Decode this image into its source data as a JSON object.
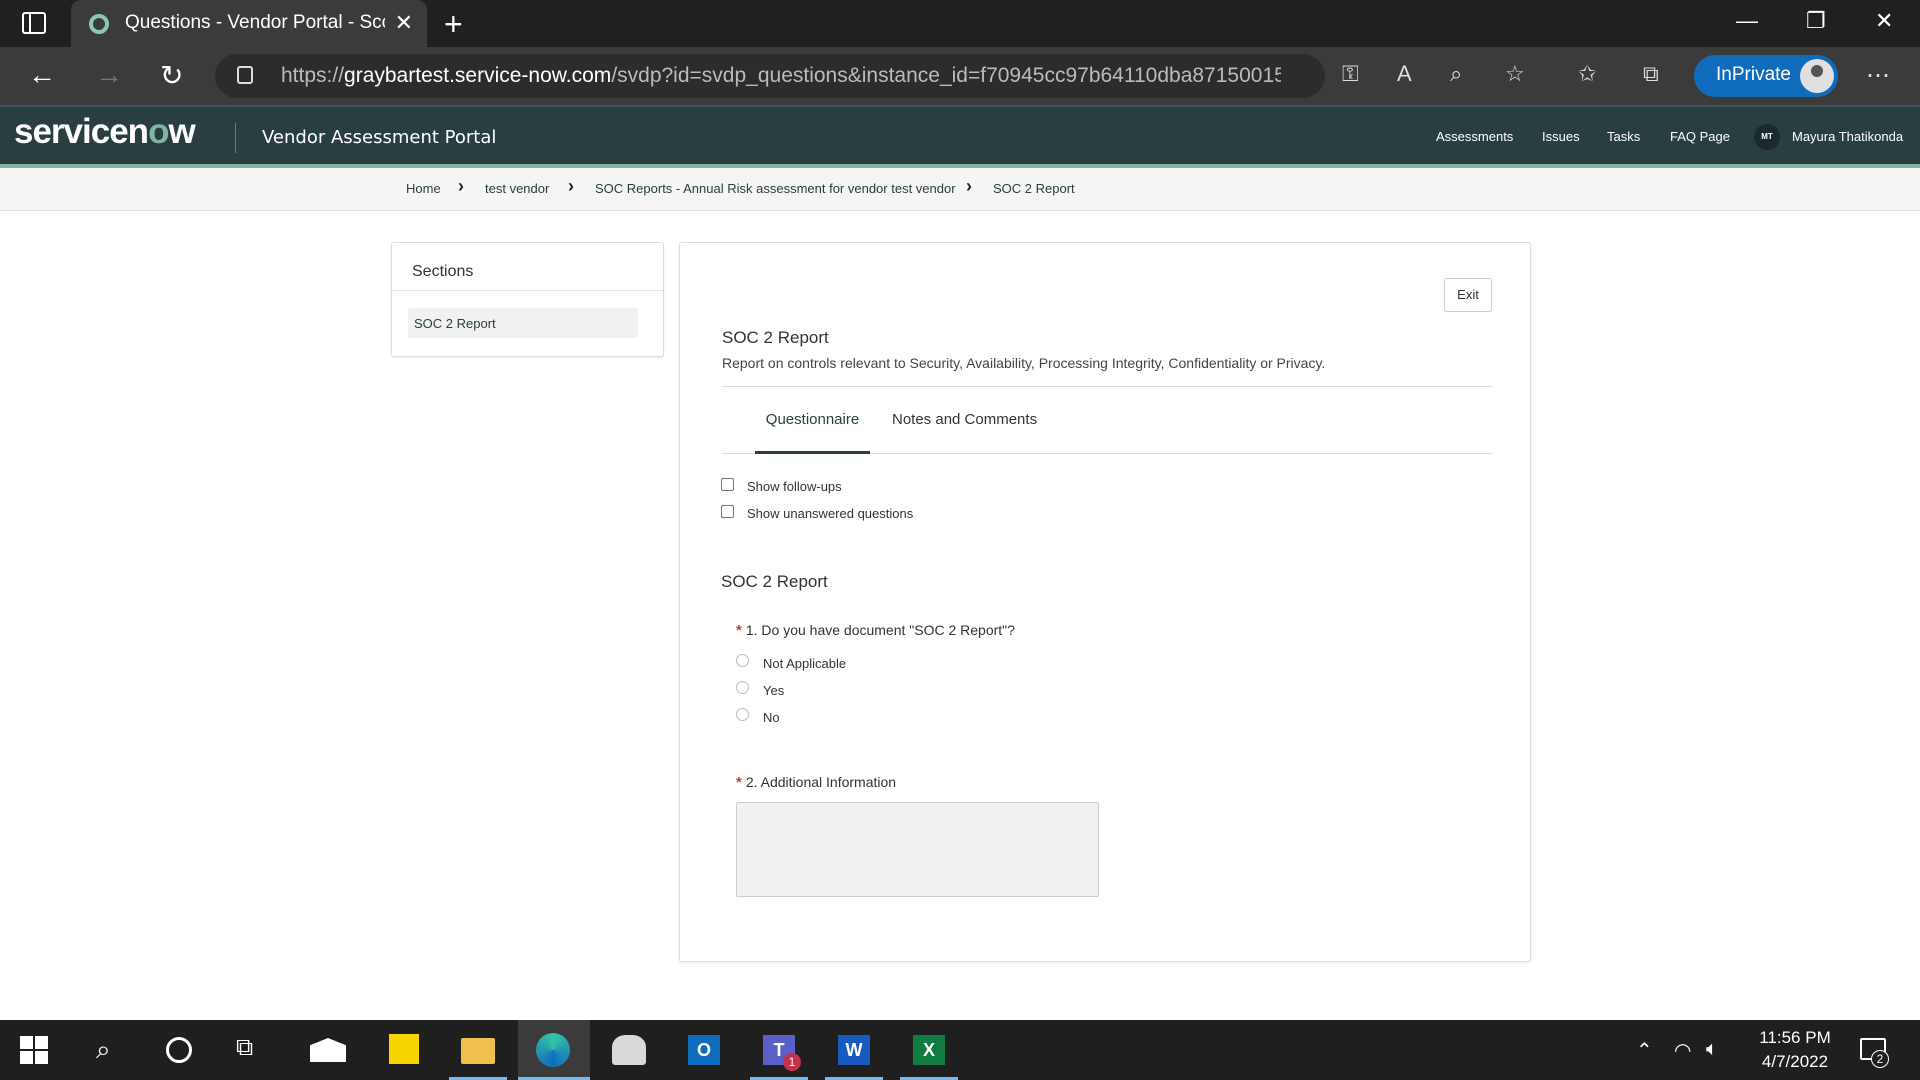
{
  "browser": {
    "tab_title": "Questions - Vendor Portal - Scoped",
    "url_host": "graybartest.service-now.com",
    "url_prefix": "https://",
    "url_path": "/svdp?id=svdp_questions&instance_id=f70945cc97b64110dba871500153...",
    "inprivate_label": "InPrivate"
  },
  "header": {
    "logo_text_1": "servicen",
    "logo_text_o": "o",
    "logo_text_2": "w",
    "portal_title": "Vendor Assessment Portal",
    "nav": [
      "Assessments",
      "Issues",
      "Tasks",
      "FAQ Page"
    ],
    "user_initials": "MT",
    "user_name": "Mayura Thatikonda"
  },
  "breadcrumb": [
    "Home",
    "test vendor",
    "SOC Reports - Annual Risk assessment for vendor test vendor",
    "SOC 2 Report"
  ],
  "sections": {
    "heading": "Sections",
    "items": [
      "SOC 2 Report"
    ]
  },
  "main": {
    "exit_label": "Exit",
    "title": "SOC 2 Report",
    "description": "Report on controls relevant to Security, Availability, Processing Integrity, Confidentiality or Privacy.",
    "tabs": [
      "Questionnaire",
      "Notes and Comments"
    ],
    "filters": [
      "Show follow-ups",
      "Show unanswered questions"
    ],
    "question_section_title": "SOC 2 Report",
    "questions": [
      {
        "required_mark": "*",
        "label": "1. Do you have document \"SOC 2 Report\"?",
        "options": [
          "Not Applicable",
          "Yes",
          "No"
        ]
      },
      {
        "required_mark": "*",
        "label": "2. Additional Information",
        "value": ""
      }
    ]
  },
  "taskbar": {
    "time": "11:56 PM",
    "date": "4/7/2022",
    "teams_badge": "1",
    "notification_count": "2"
  }
}
